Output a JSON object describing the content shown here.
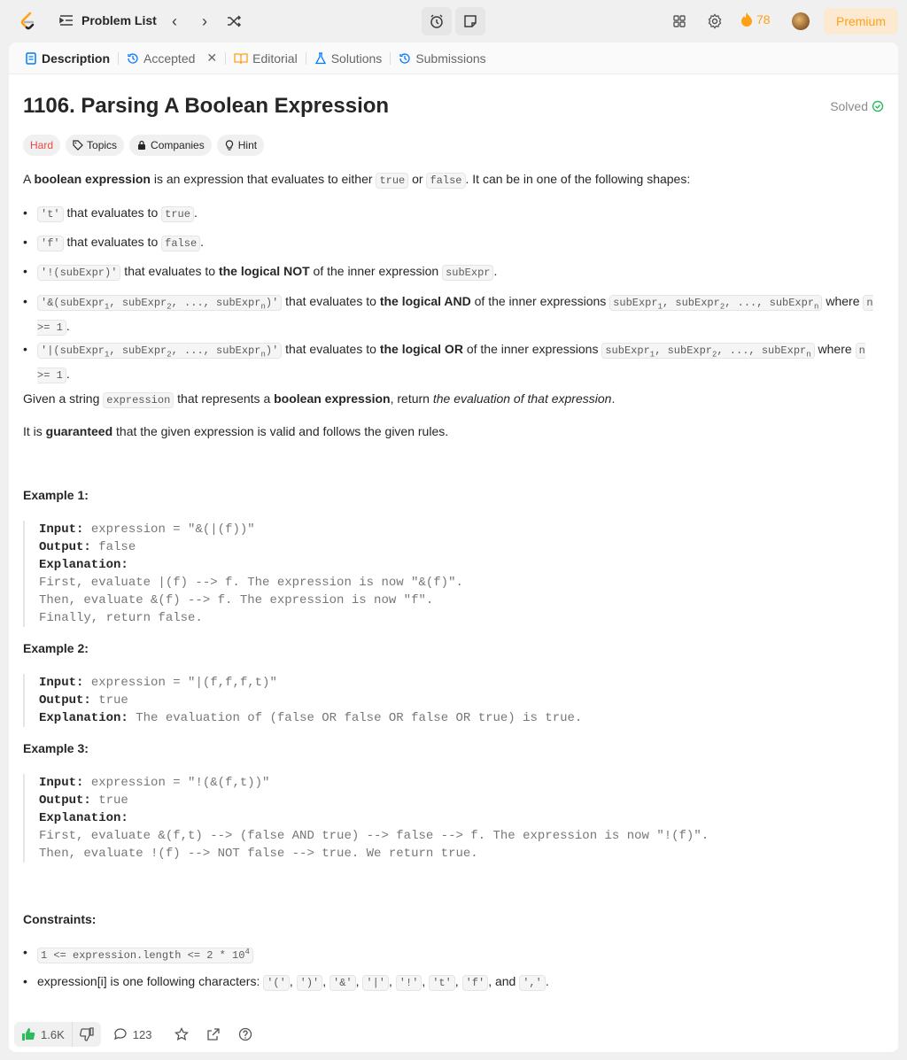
{
  "nav": {
    "problem_list": "Problem List",
    "streak": "78",
    "premium": "Premium"
  },
  "tabs": {
    "description": "Description",
    "accepted": "Accepted",
    "editorial": "Editorial",
    "solutions": "Solutions",
    "submissions": "Submissions"
  },
  "problem": {
    "title": "1106. Parsing A Boolean Expression",
    "solved": "Solved",
    "chips": {
      "difficulty": "Hard",
      "topics": "Topics",
      "companies": "Companies",
      "hint": "Hint"
    }
  },
  "body": {
    "intro_pre": "A ",
    "intro_bold": "boolean expression",
    "intro_mid": " is an expression that evaluates to either ",
    "code_true": "true",
    "intro_or": " or ",
    "code_false": "false",
    "intro_end": ". It can be in one of the following shapes:",
    "b1_code": "'t'",
    "b1_text": " that evaluates to ",
    "b1_val": "true",
    "b2_code": "'f'",
    "b2_text": " that evaluates to ",
    "b2_val": "false",
    "b3_code": "'!(subExpr)'",
    "b3_text": " that evaluates to ",
    "b3_bold": "the logical NOT",
    "b3_rest": " of the inner expression ",
    "b3_val": "subExpr",
    "given_pre": "Given a string ",
    "given_code": "expression",
    "given_mid": " that represents a ",
    "given_bold": "boolean expression",
    "given_mid2": ", return ",
    "given_italic": "the evaluation of that expression",
    "guar_pre": "It is ",
    "guar_bold": "guaranteed",
    "guar_rest": " that the given expression is valid and follows the given rules."
  },
  "examples": [
    {
      "title": "Example 1:",
      "input": "expression = \"&(|(f))\"",
      "output": "false",
      "explanation": [
        "First, evaluate |(f) --> f. The expression is now \"&(f)\".",
        "Then, evaluate &(f) --> f. The expression is now \"f\".",
        "Finally, return false."
      ]
    },
    {
      "title": "Example 2:",
      "input": "expression = \"|(f,f,f,t)\"",
      "output": "true",
      "explanation": [
        "The evaluation of (false OR false OR false OR true) is true."
      ]
    },
    {
      "title": "Example 3:",
      "input": "expression = \"!(&(f,t))\"",
      "output": "true",
      "explanation": [
        "First, evaluate &(f,t) --> (false AND true) --> false --> f. The expression is now \"!(f)\".",
        "Then, evaluate !(f) --> NOT false --> true. We return true."
      ]
    }
  ],
  "labels": {
    "input": "Input:",
    "output": "Output:",
    "explanation": "Explanation:"
  },
  "constraints": {
    "title": "Constraints:",
    "c2_text": "expression[i] is one following characters: ",
    "c2_and": ", and "
  },
  "bottom": {
    "likes": "1.6K",
    "comments": "123"
  },
  "colors": {
    "accent": "#ffa116",
    "hard": "#ef4743",
    "solved": "#2cbb5d",
    "like": "#2cbb5d"
  }
}
